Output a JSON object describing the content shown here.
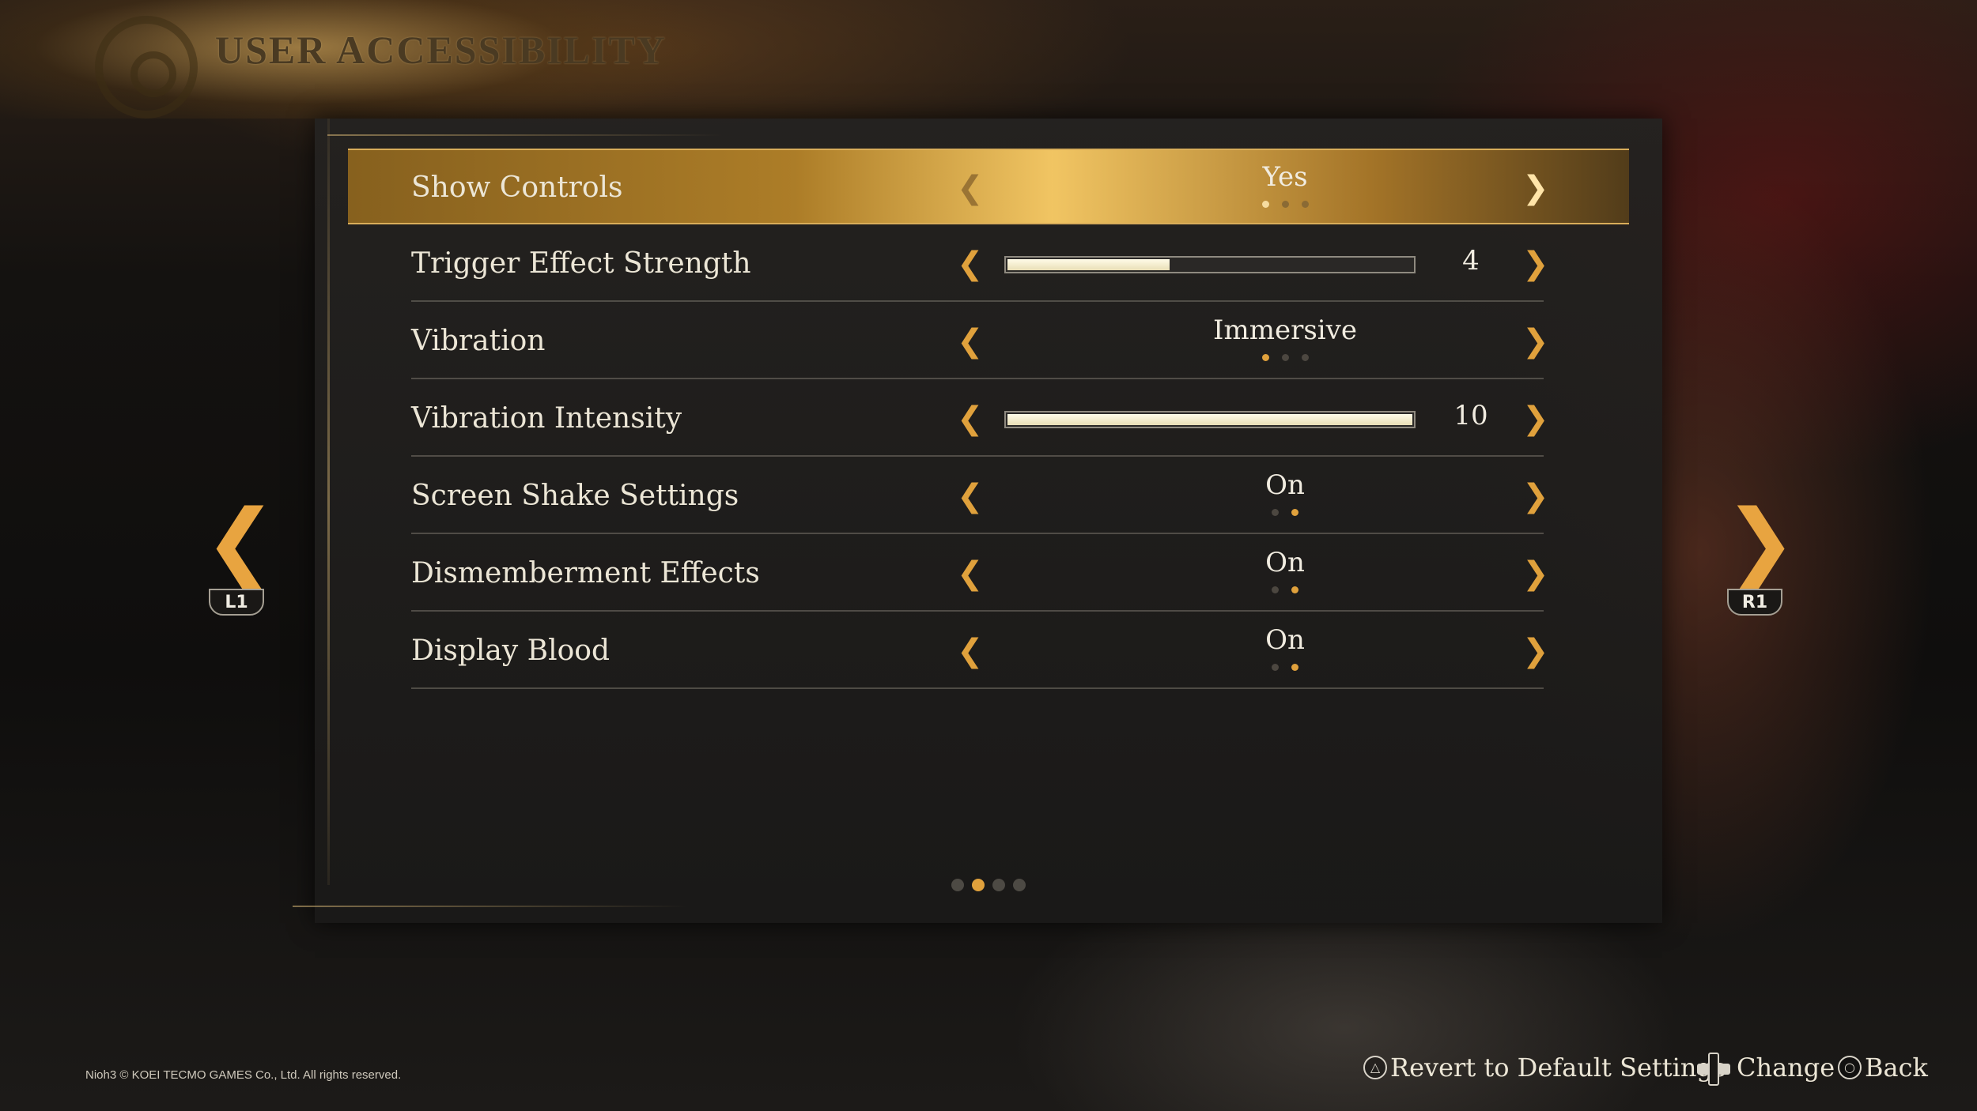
{
  "header": {
    "title": "USER ACCESSIBILITY"
  },
  "settings": [
    {
      "label": "Show Controls",
      "type": "option",
      "value": "Yes",
      "option_count": 3,
      "option_index": 0,
      "selected": true
    },
    {
      "label": "Trigger Effect Strength",
      "type": "slider",
      "value": "4",
      "level": 0.4
    },
    {
      "label": "Vibration",
      "type": "option",
      "value": "Immersive",
      "option_count": 3,
      "option_index": 0
    },
    {
      "label": "Vibration Intensity",
      "type": "slider",
      "value": "10",
      "level": 1.0
    },
    {
      "label": "Screen Shake Settings",
      "type": "option",
      "value": "On",
      "option_count": 2,
      "option_index": 1
    },
    {
      "label": "Dismemberment Effects",
      "type": "option",
      "value": "On",
      "option_count": 2,
      "option_index": 1
    },
    {
      "label": "Display Blood",
      "type": "option",
      "value": "On",
      "option_count": 2,
      "option_index": 1
    }
  ],
  "pagination": {
    "pages": 4,
    "current": 2
  },
  "nav": {
    "prev_button": "L1",
    "next_button": "R1"
  },
  "footer": {
    "copyright": "Nioh3 © KOEI TECMO GAMES Co., Ltd. All rights reserved.",
    "revert_label": "Revert to Default Settings",
    "change_label": "Change",
    "back_label": "Back"
  },
  "icons": {
    "revert": "triangle-button-icon",
    "change": "dpad-icon",
    "back": "circle-button-icon"
  },
  "colors": {
    "accent": "#e0a13c",
    "selected_row": "#f5c864"
  }
}
